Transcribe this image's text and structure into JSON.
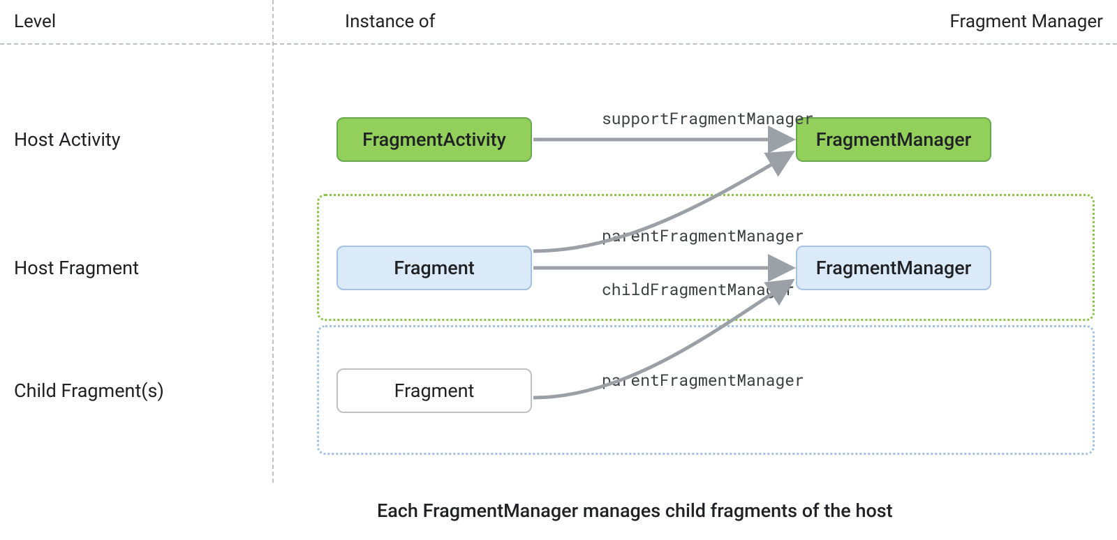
{
  "headers": {
    "level": "Level",
    "instance": "Instance of",
    "fm": "Fragment Manager"
  },
  "levels": {
    "hostActivity": "Host Activity",
    "hostFragment": "Host Fragment",
    "childFragments": "Child Fragment(s)"
  },
  "nodes": {
    "fragmentActivity": "FragmentActivity",
    "fragment1": "Fragment",
    "fragment2": "Fragment",
    "fm1": "FragmentManager",
    "fm2": "FragmentManager"
  },
  "edges": {
    "supportFM": "supportFragmentManager",
    "parentFM1": "parentFragmentManager",
    "childFM": "childFragmentManager",
    "parentFM2": "parentFragmentManager"
  },
  "caption": "Each FragmentManager manages child fragments of the host"
}
